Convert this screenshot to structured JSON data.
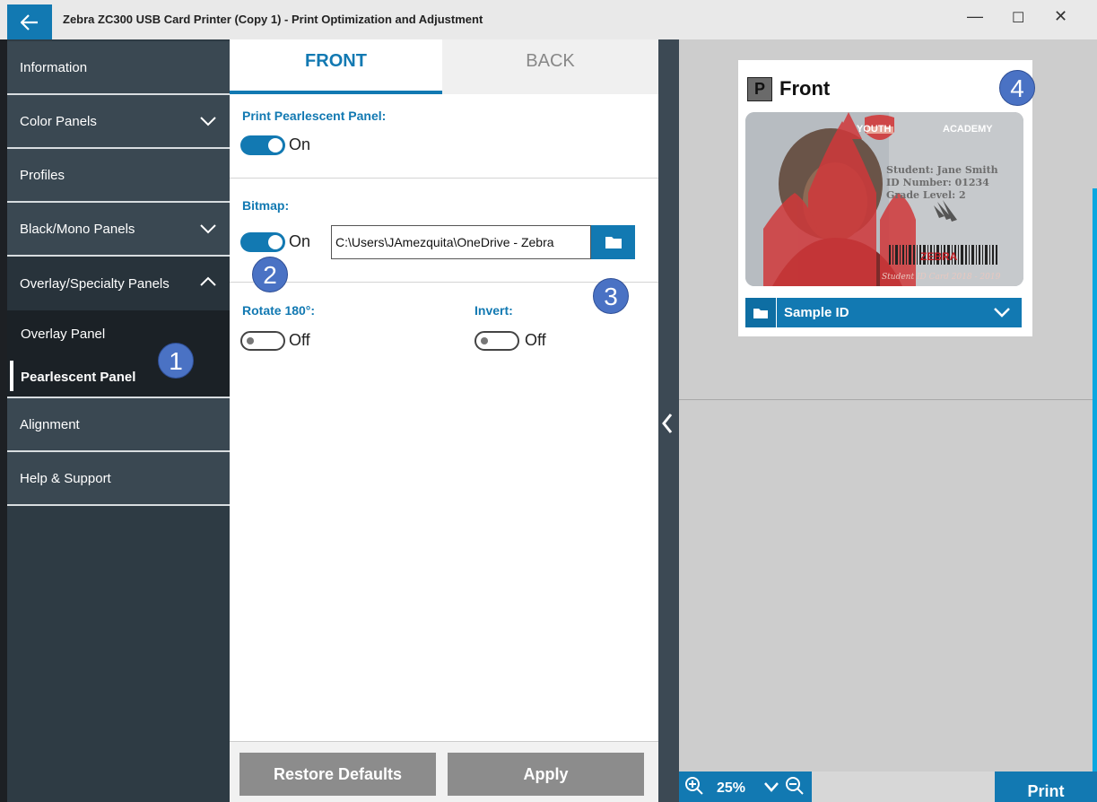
{
  "window": {
    "title": "Zebra ZC300 USB Card Printer (Copy 1) - Print Optimization and Adjustment",
    "back_icon": "arrow-left-icon",
    "minimize": "—",
    "maximize": "☐",
    "close": "✕"
  },
  "sidebar": {
    "items": [
      {
        "label": "Information"
      },
      {
        "label": "Color Panels",
        "expanded": false
      },
      {
        "label": "Profiles"
      },
      {
        "label": "Black/Mono Panels",
        "expanded": false
      },
      {
        "label": "Overlay/Specialty Panels",
        "expanded": true
      },
      {
        "label": "Alignment"
      },
      {
        "label": "Help & Support"
      }
    ],
    "subitems": [
      {
        "label": "Overlay Panel"
      },
      {
        "label": "Pearlescent Panel",
        "active": true
      }
    ]
  },
  "center": {
    "tabs": [
      {
        "label": "FRONT",
        "active": true
      },
      {
        "label": "BACK",
        "active": false
      }
    ],
    "print_pearlescent": {
      "label": "Print Pearlescent Panel:",
      "state": "On",
      "on": true
    },
    "bitmap": {
      "label": "Bitmap:",
      "state": "On",
      "on": true,
      "path": "C:\\Users\\JAmezquita\\OneDrive - Zebra"
    },
    "rotate": {
      "label": "Rotate 180°:",
      "state": "Off",
      "on": false
    },
    "invert": {
      "label": "Invert:",
      "state": "Off",
      "on": false
    },
    "buttons": {
      "restore": "Restore Defaults",
      "apply": "Apply"
    }
  },
  "preview": {
    "side_badge": "P",
    "side_title": "Front",
    "card": {
      "org_left": "YOUTH",
      "org_right": "ACADEMY",
      "student": "Student: Jane Smith",
      "id_number": "ID Number: 01234",
      "grade": "Grade Level: 2",
      "brand": "ZEBRA",
      "footer": "Student ID Card 2018 - 2019"
    },
    "template": "Sample ID",
    "zoom": "25%",
    "print_label": "Print"
  },
  "callouts": [
    "1",
    "2",
    "3",
    "4"
  ],
  "colors": {
    "accent": "#1279b2",
    "sidebar": "#3a4852",
    "callout": "#4a72c4"
  }
}
